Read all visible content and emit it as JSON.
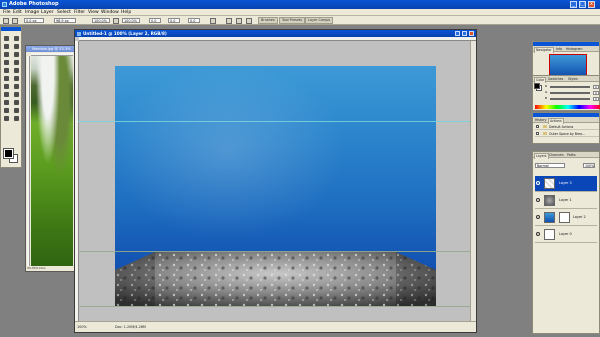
{
  "window": {
    "title": "Adobe Photoshop"
  },
  "menubar": {
    "items": [
      "File",
      "Edit",
      "Image",
      "Layer",
      "Select",
      "Filter",
      "View",
      "Window",
      "Help"
    ]
  },
  "options": {
    "fields": [
      "0.0 px",
      "98.9 px",
      "100.0%",
      "100.0%",
      "0.0",
      "0.0",
      "0.0"
    ],
    "tabs": [
      "Brushes",
      "Tool Presets",
      "Layer Comps"
    ]
  },
  "main_doc": {
    "title": "Untitled-1 @ 100% (Layer 2, RGB/8)",
    "zoom": "100%",
    "doc_size": "Doc: 1.20M/4.26M"
  },
  "grass_doc": {
    "title": "Meadow.jpg @ 33.3%",
    "zoom": "33.33%",
    "doc_size": "Doc:"
  },
  "navigator": {
    "tabs": [
      "Navigator",
      "Info",
      "Histogram"
    ]
  },
  "color_panel": {
    "tabs": [
      "Color",
      "Swatches",
      "Styles"
    ],
    "values": [
      "R",
      "G",
      "B"
    ],
    "numbers": [
      "0",
      "0",
      "0"
    ]
  },
  "actions_panel": {
    "tabs": [
      "History",
      "Actions"
    ],
    "rows": [
      "Default Actions",
      "Outer Space by Brea..."
    ]
  },
  "layers_panel": {
    "tabs": [
      "Layers",
      "Channels",
      "Paths"
    ],
    "blend_mode": "Normal",
    "opacity": "100%",
    "layers": [
      {
        "name": "Layer 3",
        "selected": true
      },
      {
        "name": "Layer 1",
        "selected": false
      },
      {
        "name": "Layer 2",
        "selected": false
      },
      {
        "name": "Layer 0",
        "selected": false
      }
    ]
  },
  "colors": {
    "titlebar": "#0a55d6",
    "chrome": "#ece9d8",
    "canvas_top": "#3d9ad6",
    "canvas_bottom": "#0f46a8",
    "selected_layer": "#0a46b8"
  }
}
